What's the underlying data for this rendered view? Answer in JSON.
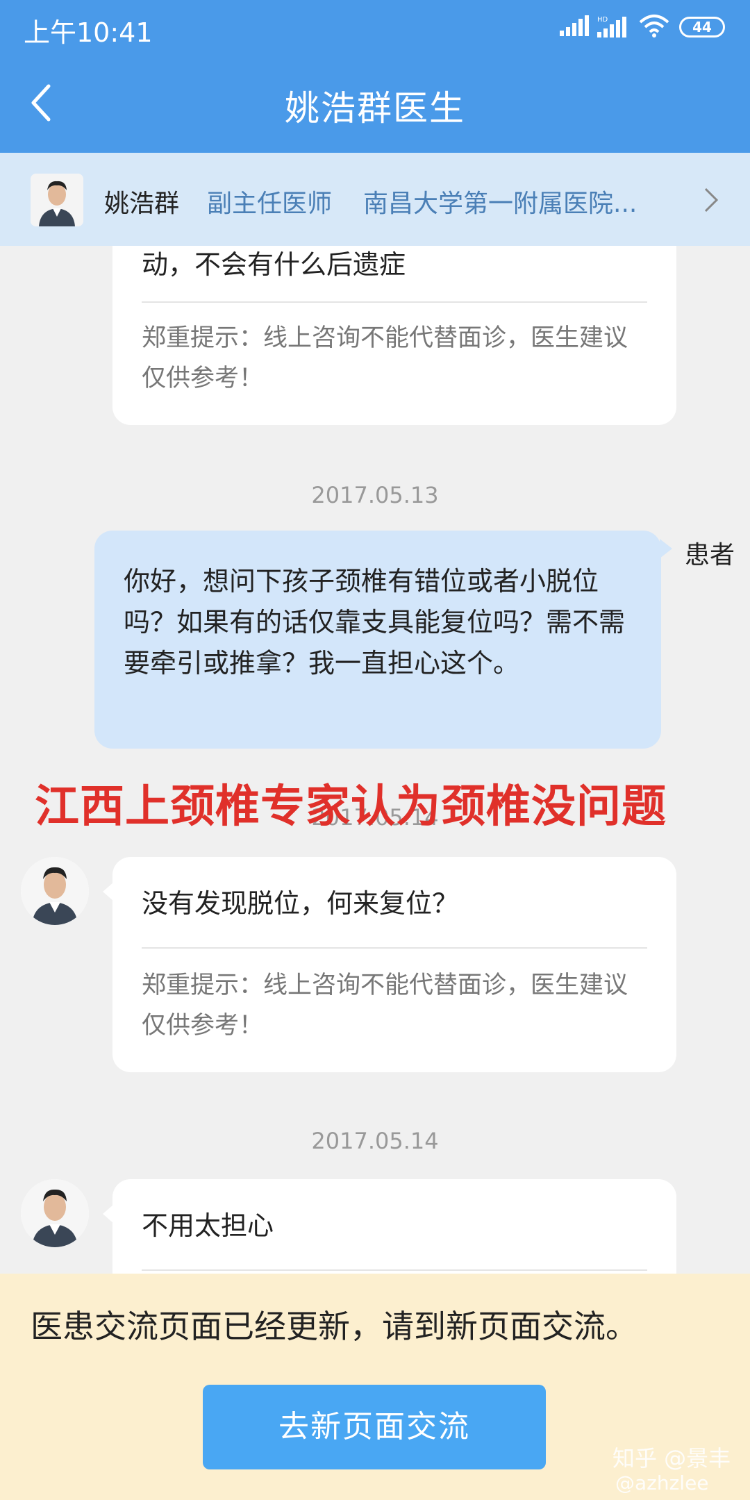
{
  "status_bar": {
    "time": "上午10:41",
    "hd_label": "HD",
    "battery": "44"
  },
  "header": {
    "title": "姚浩群医生"
  },
  "doctor_bar": {
    "name": "姚浩群",
    "rank": "副主任医师",
    "hospital": "南昌大学第一附属医院..."
  },
  "messages": [
    {
      "sender": "doctor",
      "text": "动，不会有什么后遗症",
      "tip": "郑重提示：线上咨询不能代替面诊，医生建议仅供参考！"
    },
    {
      "date": "2017.05.13",
      "sender": "patient",
      "sender_label": "患者",
      "text": "你好，想问下孩子颈椎有错位或者小脱位吗？如果有的话仅靠支具能复位吗？需不需要牵引或推拿？我一直担心这个。"
    },
    {
      "date": "2017.05.14",
      "sender": "doctor",
      "text": "没有发现脱位，何来复位？",
      "tip": "郑重提示：线上咨询不能代替面诊，医生建议仅供参考！"
    },
    {
      "date": "2017.05.14",
      "sender": "doctor",
      "text": "不用太担心"
    }
  ],
  "overlay_caption": "江西上颈椎专家认为颈椎没问题",
  "banner": {
    "notice": "医患交流页面已经更新，请到新页面交流。",
    "button_label": "去新页面交流"
  },
  "watermark": {
    "line1": "知乎 @景丰",
    "line2": "@azhzlee"
  },
  "colors": {
    "header_blue": "#4a9ae9",
    "doctor_bar_bg": "#d7e8f8",
    "patient_bubble": "#d3e6fa",
    "banner_bg": "#fcefcf",
    "button_blue": "#49a7f3",
    "overlay_red": "#e0302a"
  }
}
